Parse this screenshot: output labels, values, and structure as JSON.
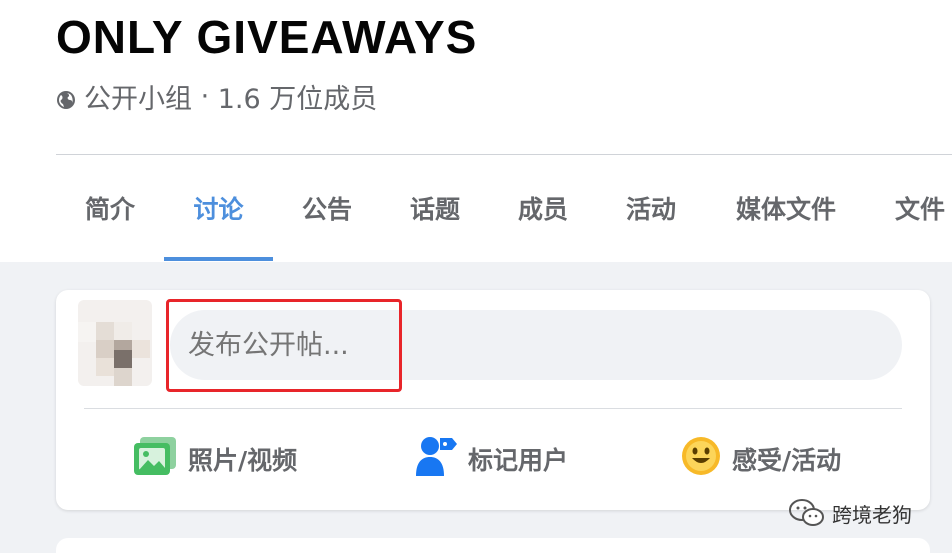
{
  "group": {
    "name": "ONLY GIVEAWAYS",
    "privacy": "公开小组",
    "members": "1.6 万位成员"
  },
  "tabs": [
    {
      "label": "简介",
      "active": false
    },
    {
      "label": "讨论",
      "active": true
    },
    {
      "label": "公告",
      "active": false
    },
    {
      "label": "话题",
      "active": false
    },
    {
      "label": "成员",
      "active": false
    },
    {
      "label": "活动",
      "active": false
    },
    {
      "label": "媒体文件",
      "active": false
    },
    {
      "label": "文件",
      "active": false
    }
  ],
  "composer": {
    "placeholder": "发布公开帖..."
  },
  "actions": [
    {
      "label": "照片/视频",
      "icon": "photo-video-icon"
    },
    {
      "label": "标记用户",
      "icon": "tag-people-icon"
    },
    {
      "label": "感受/活动",
      "icon": "feeling-activity-icon"
    }
  ],
  "watermark": {
    "text": "跨境老狗"
  },
  "colors": {
    "accent": "#4d8fdd",
    "highlight": "#e8252a",
    "photo_icon": "#45bd62",
    "tag_icon": "#1877f2",
    "feeling_icon": "#f7b928"
  }
}
